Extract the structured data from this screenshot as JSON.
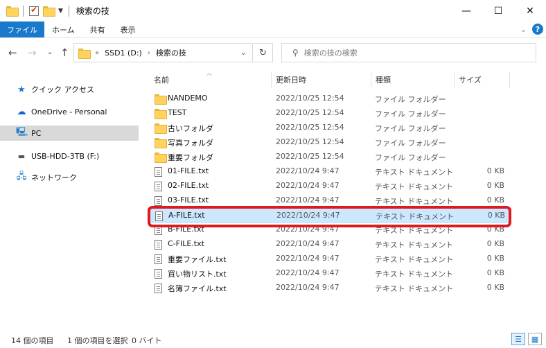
{
  "window": {
    "title": "検索の技",
    "controls": {
      "minimize": "—",
      "maximize": "☐",
      "close": "✕"
    }
  },
  "ribbon": {
    "tabs": [
      {
        "label": "ファイル"
      },
      {
        "label": "ホーム"
      },
      {
        "label": "共有"
      },
      {
        "label": "表示"
      }
    ],
    "collapse_glyph": "⌄",
    "help_glyph": "?"
  },
  "nav": {
    "back": "←",
    "forward": "→",
    "recent": "⌄",
    "up": "↑"
  },
  "address": {
    "overflow": "«",
    "crumbs": [
      "SSD1 (D:)",
      "検索の技"
    ],
    "separator": "›",
    "dropdown": "⌄",
    "refresh": "↻"
  },
  "search": {
    "placeholder": "検索の技の検索",
    "value": ""
  },
  "navpane": {
    "items": [
      {
        "label": "クイック アクセス",
        "icon": "star-icon"
      },
      {
        "label": "OneDrive - Personal",
        "icon": "cloud-icon"
      },
      {
        "label": "PC",
        "icon": "computer-icon",
        "selected": true
      },
      {
        "label": "USB-HDD-3TB (F:)",
        "icon": "drive-icon"
      },
      {
        "label": "ネットワーク",
        "icon": "network-icon"
      }
    ]
  },
  "columns": {
    "name": "名前",
    "date": "更新日時",
    "type": "種類",
    "size": "サイズ"
  },
  "files": [
    {
      "name": "NANDEMO",
      "date": "2022/10/25 12:54",
      "type": "ファイル フォルダー",
      "size": "",
      "kind": "folder"
    },
    {
      "name": "TEST",
      "date": "2022/10/25 12:54",
      "type": "ファイル フォルダー",
      "size": "",
      "kind": "folder"
    },
    {
      "name": "古いフォルダ",
      "date": "2022/10/25 12:54",
      "type": "ファイル フォルダー",
      "size": "",
      "kind": "folder"
    },
    {
      "name": "写真フォルダ",
      "date": "2022/10/25 12:54",
      "type": "ファイル フォルダー",
      "size": "",
      "kind": "folder"
    },
    {
      "name": "重要フォルダ",
      "date": "2022/10/25 12:54",
      "type": "ファイル フォルダー",
      "size": "",
      "kind": "folder"
    },
    {
      "name": "01-FILE.txt",
      "date": "2022/10/24 9:47",
      "type": "テキスト ドキュメント",
      "size": "0 KB",
      "kind": "text"
    },
    {
      "name": "02-FILE.txt",
      "date": "2022/10/24 9:47",
      "type": "テキスト ドキュメント",
      "size": "0 KB",
      "kind": "text"
    },
    {
      "name": "03-FILE.txt",
      "date": "2022/10/24 9:47",
      "type": "テキスト ドキュメント",
      "size": "0 KB",
      "kind": "text"
    },
    {
      "name": "A-FILE.txt",
      "date": "2022/10/24 9:47",
      "type": "テキスト ドキュメント",
      "size": "0 KB",
      "kind": "text",
      "selected": true
    },
    {
      "name": "B-FILE.txt",
      "date": "2022/10/24 9:47",
      "type": "テキスト ドキュメント",
      "size": "0 KB",
      "kind": "text"
    },
    {
      "name": "C-FILE.txt",
      "date": "2022/10/24 9:47",
      "type": "テキスト ドキュメント",
      "size": "0 KB",
      "kind": "text"
    },
    {
      "name": "重要ファイル.txt",
      "date": "2022/10/24 9:47",
      "type": "テキスト ドキュメント",
      "size": "0 KB",
      "kind": "text"
    },
    {
      "name": "買い物リスト.txt",
      "date": "2022/10/24 9:47",
      "type": "テキスト ドキュメント",
      "size": "0 KB",
      "kind": "text"
    },
    {
      "name": "名簿ファイル.txt",
      "date": "2022/10/24 9:47",
      "type": "テキスト ドキュメント",
      "size": "0 KB",
      "kind": "text"
    }
  ],
  "status": {
    "count": "14 個の項目",
    "selection": "1 個の項目を選択",
    "size": "0 バイト"
  },
  "colors": {
    "accent": "#1979ca",
    "selection_bg": "#cce8ff",
    "highlight_border": "#e0191f",
    "folder": "#ffd35c"
  }
}
